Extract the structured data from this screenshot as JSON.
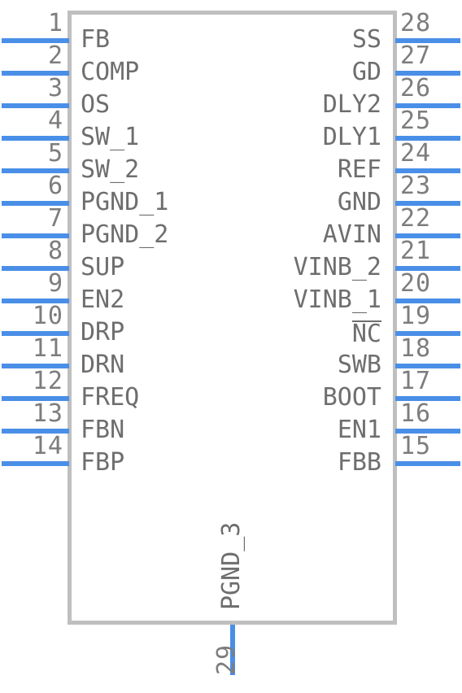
{
  "symbol": {
    "kind": "ic-schematic-symbol",
    "body_fill": "#ffffff",
    "body_border_color": "#bfbfbf",
    "pin_wire_color": "#4a8fe7",
    "pin_number_color": "#7d7d7d",
    "pin_name_color": "#6e6e6e",
    "total_pins": 29
  },
  "pins": {
    "left": [
      {
        "number": "1",
        "name": "FB"
      },
      {
        "number": "2",
        "name": "COMP"
      },
      {
        "number": "3",
        "name": "OS"
      },
      {
        "number": "4",
        "name": "SW_1"
      },
      {
        "number": "5",
        "name": "SW_2"
      },
      {
        "number": "6",
        "name": "PGND_1"
      },
      {
        "number": "7",
        "name": "PGND_2"
      },
      {
        "number": "8",
        "name": "SUP"
      },
      {
        "number": "9",
        "name": "EN2"
      },
      {
        "number": "10",
        "name": "DRP"
      },
      {
        "number": "11",
        "name": "DRN"
      },
      {
        "number": "12",
        "name": "FREQ"
      },
      {
        "number": "13",
        "name": "FBN"
      },
      {
        "number": "14",
        "name": "FBP"
      }
    ],
    "right": [
      {
        "number": "28",
        "name": "SS"
      },
      {
        "number": "27",
        "name": "GD"
      },
      {
        "number": "26",
        "name": "DLY2"
      },
      {
        "number": "25",
        "name": "DLY1"
      },
      {
        "number": "24",
        "name": "REF"
      },
      {
        "number": "23",
        "name": "GND"
      },
      {
        "number": "22",
        "name": "AVIN"
      },
      {
        "number": "21",
        "name": "VINB_2"
      },
      {
        "number": "20",
        "name": "VINB_1"
      },
      {
        "number": "19",
        "name": "NC",
        "overline": true
      },
      {
        "number": "18",
        "name": "SWB"
      },
      {
        "number": "17",
        "name": "BOOT"
      },
      {
        "number": "16",
        "name": "EN1"
      },
      {
        "number": "15",
        "name": "FBB"
      }
    ],
    "bottom": [
      {
        "number": "29",
        "name": "PGND_3"
      }
    ]
  }
}
